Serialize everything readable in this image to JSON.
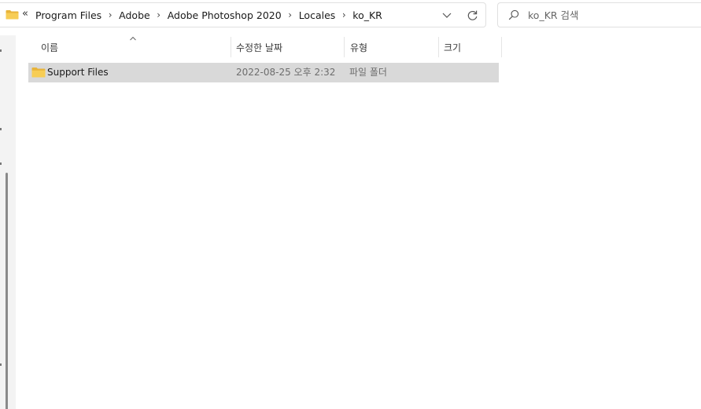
{
  "address_bar": {
    "overflow_label": "«",
    "crumbs": [
      "Program Files",
      "Adobe",
      "Adobe Photoshop 2020",
      "Locales",
      "ko_KR"
    ],
    "separator": "›",
    "icons": {
      "location": "folder-icon",
      "history": "chevron-down-icon",
      "refresh": "refresh-icon"
    }
  },
  "search": {
    "placeholder": "ko_KR 검색",
    "value": "",
    "icon": "search-icon"
  },
  "file_list": {
    "sort_indicator": "chevron-up-icon",
    "columns": [
      {
        "label": "이름"
      },
      {
        "label": "수정한 날짜"
      },
      {
        "label": "유형"
      },
      {
        "label": "크기"
      }
    ],
    "rows": [
      {
        "name": "Support Files",
        "modified": "2022-08-25 오후 2:32",
        "type": "파일 폴더",
        "size": "",
        "icon": "folder-icon",
        "selected": true
      }
    ]
  },
  "colors": {
    "folder_yellow": "#f0c34a",
    "selected_row": "#d9d9d9",
    "nav_pane": "#f3f3f3"
  }
}
